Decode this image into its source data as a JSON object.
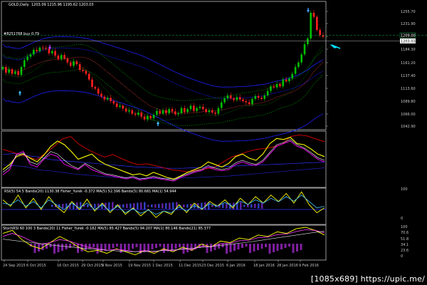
{
  "chart_header": {
    "symbol_label": "GOLD,Daily",
    "quote": "1203.09 1215.96 1195.62 1203.03",
    "order_label": "#8251768 buy 0.79"
  },
  "current_price_tag": "1203.03",
  "order_price_tag": "1209.00",
  "indicator_labels": {
    "panel3": "RSI(5) 54.5  Bands(20) 1130.38  Fisher_Yurek -0.372  MA(5) 52.396  Bands(5) 80.681  MA(1) 54.944",
    "panel4": "StochRSI 60 100 3 Bands(20) 11 Fisher_Yurek -0.182  MA(5) 85.427  Bands(5) 94.207  MA(1) 80.146  Bands(21) 85.377"
  },
  "watermark": "[1085x689]  https://upic.me/",
  "colors": {
    "background": "#000000",
    "bull_candle": "#00c000",
    "bear_candle": "#ff2020",
    "yellow_line": "#ffff00",
    "magenta_line": "#ff00ff",
    "red_line": "#e00000",
    "blue_line": "#0000ff",
    "cyan_arrow": "#00e0ff",
    "order_line": "#00b050"
  },
  "chart_data": [
    {
      "type": "candlestick",
      "title": "GOLD,Daily",
      "y_tick_labels": [
        "1255.70",
        "1231.90",
        "1208.10",
        "1184.30",
        "1161.20",
        "1137.40",
        "1113.60",
        "1089.80",
        "1066.00",
        "1042.90"
      ],
      "ylim": [
        1040,
        1265
      ],
      "x_tick_labels": [
        "24 Sep 2015",
        "6 Oct 2015",
        "16 Oct 2015",
        "29 Oct 2015",
        "9 Nov 2015",
        "19 Nov 2015",
        "1 Dec 2015",
        "11 Dec 2015",
        "23 Dec 2015",
        "6 Jan 2016",
        "18 Jan 2016",
        "28 Jan 2016",
        "9 Feb 2016"
      ],
      "close": [
        1150,
        1140,
        1146,
        1138,
        1142,
        1136,
        1150,
        1162,
        1168,
        1172,
        1180,
        1178,
        1184,
        1183,
        1182,
        1174,
        1178,
        1170,
        1164,
        1171,
        1165,
        1158,
        1152,
        1160,
        1155,
        1145,
        1143,
        1138,
        1128,
        1115,
        1112,
        1103,
        1098,
        1093,
        1096,
        1090,
        1086,
        1080,
        1082,
        1077,
        1072,
        1074,
        1068,
        1066,
        1070,
        1063,
        1058,
        1064,
        1060,
        1066,
        1073,
        1068,
        1074,
        1069,
        1076,
        1072,
        1067,
        1069,
        1078,
        1071,
        1076,
        1082,
        1073,
        1078,
        1080,
        1076,
        1071,
        1074,
        1070,
        1068,
        1078,
        1088,
        1095,
        1100,
        1095,
        1092,
        1097,
        1093,
        1090,
        1088,
        1085,
        1094,
        1099,
        1096,
        1094,
        1100,
        1108,
        1116,
        1114,
        1120,
        1116,
        1128,
        1125,
        1130,
        1138,
        1150,
        1158,
        1172,
        1190,
        1200,
        1245,
        1238,
        1215,
        1206,
        1203
      ]
    },
    {
      "type": "line",
      "series": [
        {
          "name": "",
          "values": [
            30,
            40,
            55,
            60,
            52,
            45,
            58,
            75,
            85,
            78,
            65,
            50,
            55,
            60,
            48,
            40,
            35,
            30,
            25,
            20,
            22,
            18,
            25,
            20,
            15,
            12,
            18,
            25,
            30,
            35,
            45,
            40,
            35,
            42,
            55,
            60,
            52,
            48,
            60,
            80,
            90,
            88,
            92,
            80,
            78,
            70,
            60,
            55
          ]
        },
        {
          "name": "",
          "values": [
            20,
            30,
            60,
            65,
            40,
            35,
            50,
            60,
            55,
            40,
            35,
            30,
            40,
            30,
            25,
            20,
            18,
            15,
            12,
            15,
            10,
            12,
            15,
            12,
            10,
            8,
            15,
            20,
            25,
            28,
            35,
            30,
            28,
            30,
            40,
            45,
            40,
            38,
            45,
            60,
            75,
            80,
            85,
            75,
            70,
            60,
            50,
            45
          ]
        },
        {
          "name": "",
          "values": [
            25,
            35,
            58,
            62,
            45,
            40,
            52,
            65,
            60,
            48,
            38,
            32,
            42,
            35,
            28,
            22,
            20,
            17,
            14,
            17,
            12,
            14,
            17,
            14,
            12,
            10,
            17,
            22,
            27,
            30,
            38,
            33,
            30,
            33,
            43,
            48,
            43,
            40,
            48,
            63,
            78,
            82,
            88,
            78,
            72,
            63,
            53,
            48
          ]
        }
      ]
    },
    {
      "type": "line",
      "series": [
        {
          "name": "",
          "values": [
            70,
            50,
            85,
            45,
            75,
            40,
            80,
            50,
            30,
            65,
            40,
            72,
            35,
            60,
            30,
            55,
            25,
            45,
            20,
            40,
            15,
            35,
            25,
            55,
            30,
            60,
            40,
            65,
            50,
            70,
            45,
            75,
            55,
            80,
            60,
            85,
            65,
            90,
            60,
            95,
            55,
            30,
            45
          ]
        },
        {
          "name": "",
          "values": [
            60,
            55,
            70,
            50,
            65,
            45,
            70,
            55,
            40,
            60,
            45,
            60,
            40,
            55,
            35,
            50,
            30,
            42,
            28,
            38,
            25,
            35,
            30,
            48,
            35,
            52,
            42,
            58,
            50,
            62,
            50,
            66,
            56,
            70,
            60,
            75,
            64,
            80,
            66,
            85,
            65,
            45,
            50
          ]
        }
      ]
    },
    {
      "type": "line",
      "series": [
        {
          "name": "",
          "values": [
            80,
            90,
            60,
            40,
            30,
            50,
            70,
            55,
            35,
            20,
            25,
            15,
            30,
            20,
            10,
            25,
            15,
            30,
            20,
            35,
            25,
            45,
            35,
            55,
            50,
            65,
            60,
            75,
            70,
            85,
            80,
            95,
            100,
            90,
            75
          ]
        },
        {
          "name": "",
          "values": [
            70,
            80,
            70,
            55,
            45,
            50,
            60,
            55,
            45,
            35,
            30,
            25,
            28,
            25,
            20,
            24,
            20,
            26,
            24,
            30,
            28,
            38,
            36,
            46,
            48,
            56,
            58,
            66,
            68,
            76,
            78,
            86,
            92,
            90,
            82
          ]
        }
      ]
    }
  ]
}
